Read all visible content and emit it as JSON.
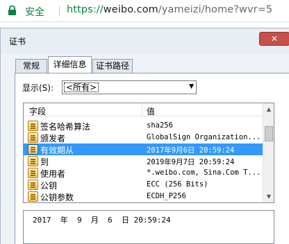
{
  "browser": {
    "secure_label": "安全",
    "url_scheme": "https://",
    "url_host": "weibo.com",
    "url_path": "/yameizi/home?wvr=5"
  },
  "dialog": {
    "title": "证书",
    "close_label": "✕",
    "tabs": [
      "常规",
      "详细信息",
      "证书路径"
    ],
    "show_label": "显示(S):",
    "show_value": "<所有>",
    "list": {
      "columns": [
        "字段",
        "值"
      ],
      "rows": [
        {
          "field": "签名哈希算法",
          "value": "sha256"
        },
        {
          "field": "颁发者",
          "value": "GlobalSign Organization..."
        },
        {
          "field": "有效期从",
          "value": "2017年9月6日 20:59:24"
        },
        {
          "field": "到",
          "value": "2019年9月7日 20:59:24"
        },
        {
          "field": "使用者",
          "value": "*.weibo.com, Sina.Com T..."
        },
        {
          "field": "公钥",
          "value": "ECC (256 Bits)"
        },
        {
          "field": "公钥参数",
          "value": "ECDH_P256"
        }
      ],
      "selected_index": 2
    },
    "detail_value": "2017  年  9  月  6  日 20:59:24"
  }
}
